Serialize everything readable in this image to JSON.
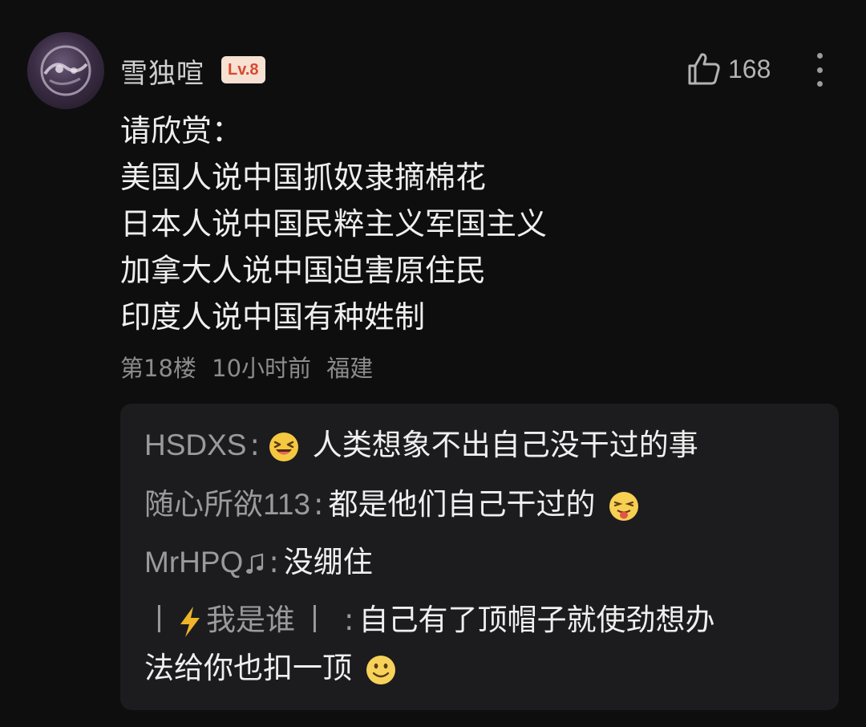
{
  "comment": {
    "author": "雪独喧",
    "level": "Lv.8",
    "like_count": "168",
    "lines": [
      "请欣赏：",
      "美国人说中国抓奴隶摘棉花",
      "日本人说中国民粹主义军国主义",
      "加拿大人说中国迫害原住民",
      "印度人说中国有种姓制"
    ],
    "floor": "第18楼",
    "time": "10小时前",
    "location": "福建"
  },
  "replies": [
    {
      "author": "HSDXS",
      "separator": ":",
      "emoji": "laughing-emoji",
      "text": "人类想象不出自己没干过的事"
    },
    {
      "author": "随心所欲113",
      "separator": ":",
      "text": "都是他们自己干过的",
      "emoji": "tongue-emoji"
    },
    {
      "author": "MrHPQ",
      "author_icon": "music-note-icon",
      "separator": ":",
      "text": "没绷住"
    },
    {
      "author_prefix": "丨",
      "author_icon": "lightning-icon",
      "author": "我是谁",
      "author_suffix": "丨",
      "separator": ":",
      "text_line1": "自己有了顶帽子就使劲想办",
      "text_line2": "法给你也扣一顶",
      "emoji": "smile-emoji"
    }
  ],
  "colors": {
    "background": "#0e0e0f",
    "reply_panel": "#1c1c1e",
    "badge_bg": "#f6e1d3",
    "badge_text": "#d84a2f",
    "muted_text": "#8c8c8c"
  }
}
